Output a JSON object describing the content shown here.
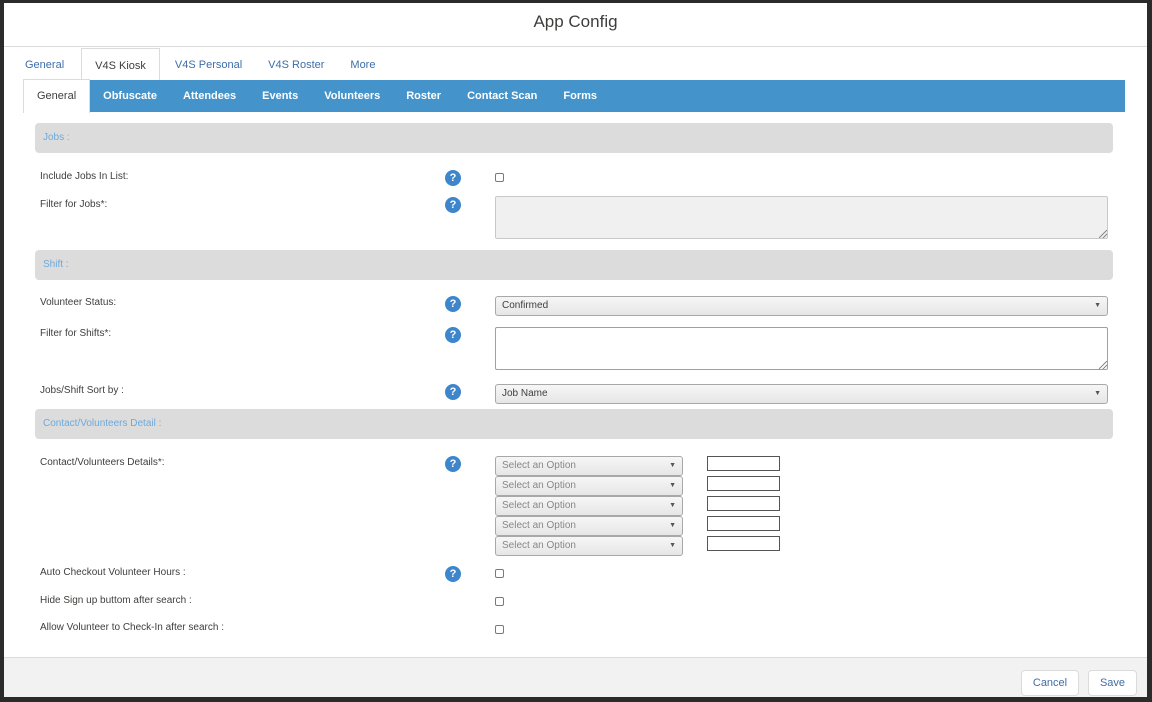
{
  "window": {
    "title": "App Config"
  },
  "tabs": [
    {
      "label": "General",
      "active": false
    },
    {
      "label": "V4S Kiosk",
      "active": true
    },
    {
      "label": "V4S Personal",
      "active": false
    },
    {
      "label": "V4S Roster",
      "active": false
    },
    {
      "label": "More",
      "active": false
    }
  ],
  "subtabs": [
    {
      "label": "General",
      "active": true
    },
    {
      "label": "Obfuscate",
      "active": false
    },
    {
      "label": "Attendees",
      "active": false
    },
    {
      "label": "Events",
      "active": false
    },
    {
      "label": "Volunteers",
      "active": false
    },
    {
      "label": "Roster",
      "active": false
    },
    {
      "label": "Contact Scan",
      "active": false
    },
    {
      "label": "Forms",
      "active": false
    }
  ],
  "sections": {
    "jobs": "Jobs :",
    "shift": "Shift :",
    "contact": "Contact/Volunteers Detail :"
  },
  "fields": {
    "include_jobs": {
      "label": "Include Jobs In List:",
      "checked": false
    },
    "filter_jobs": {
      "label": "Filter for Jobs*:",
      "value": ""
    },
    "volunteer_status": {
      "label": "Volunteer Status:",
      "value": "Confirmed"
    },
    "filter_shifts": {
      "label": "Filter for Shifts*:",
      "value": ""
    },
    "sort_by": {
      "label": "Jobs/Shift Sort by :",
      "value": "Job Name"
    },
    "contact_details": {
      "label": "Contact/Volunteers Details*:",
      "rows": [
        {
          "select": "Select an Option",
          "value": ""
        },
        {
          "select": "Select an Option",
          "value": ""
        },
        {
          "select": "Select an Option",
          "value": ""
        },
        {
          "select": "Select an Option",
          "value": ""
        },
        {
          "select": "Select an Option",
          "value": ""
        }
      ]
    },
    "auto_checkout": {
      "label": "Auto Checkout Volunteer Hours :",
      "checked": false
    },
    "hide_signup": {
      "label": "Hide Sign up buttom after search :",
      "checked": false
    },
    "allow_checkin": {
      "label": "Allow Volunteer to Check-In after search :",
      "checked": false
    }
  },
  "help_glyph": "?",
  "caret_glyph": "▼",
  "footer": {
    "cancel": "Cancel",
    "save": "Save"
  }
}
